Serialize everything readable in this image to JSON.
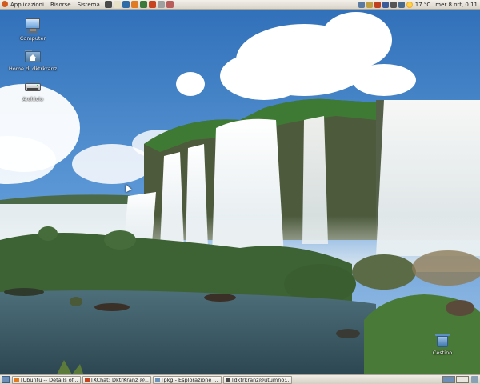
{
  "top_panel": {
    "menus": [
      {
        "label": "Applicazioni"
      },
      {
        "label": "Risorse"
      },
      {
        "label": "Sistema"
      }
    ],
    "launchers": [
      {
        "icon": "terminal-icon",
        "color": "#4a4a4a"
      },
      {
        "icon": "text-editor-icon",
        "color": "#e8e2c8"
      },
      {
        "icon": "browser-icon",
        "color": "#2d6aa8"
      },
      {
        "icon": "firefox-icon",
        "color": "#e07b24"
      },
      {
        "icon": "chat-icon",
        "color": "#3c7a3c"
      },
      {
        "icon": "xchat-icon",
        "color": "#c8431f"
      },
      {
        "icon": "gnome-foot-icon",
        "color": "#a0a0a0"
      },
      {
        "icon": "user-icon",
        "color": "#b85c5c"
      }
    ],
    "tray_icons": [
      {
        "icon": "network-icon",
        "color": "#5a7aa0"
      },
      {
        "icon": "mail-icon",
        "color": "#c0a040"
      },
      {
        "icon": "update-icon",
        "color": "#c04020"
      },
      {
        "icon": "bluetooth-icon",
        "color": "#3a5a9a"
      },
      {
        "icon": "volume-icon",
        "color": "#555555"
      },
      {
        "icon": "display-icon",
        "color": "#4a6a8a"
      }
    ],
    "weather": "17 °C",
    "clock": "mer  8 ott,  0.11"
  },
  "desktop": {
    "icons": [
      {
        "label": "Computer"
      },
      {
        "label": "Home di dktrkranz"
      },
      {
        "label": "Archivio"
      },
      {
        "label": "Cestino"
      }
    ]
  },
  "taskbar": {
    "tasks": [
      {
        "label": "[Ubuntu -- Details of...",
        "icon_color": "#e07b24"
      },
      {
        "label": "[XChat: DktrKranz @...",
        "icon_color": "#c8431f"
      },
      {
        "label": "[pkg - Esplorazione ...",
        "icon_color": "#6e93ba"
      },
      {
        "label": "[dktrkranz@utumno:...",
        "icon_color": "#4a4a4a"
      }
    ]
  },
  "colors": {
    "sky": "#3e7fc4",
    "water": "#3b5f6e",
    "panel": "#e6e2da"
  }
}
